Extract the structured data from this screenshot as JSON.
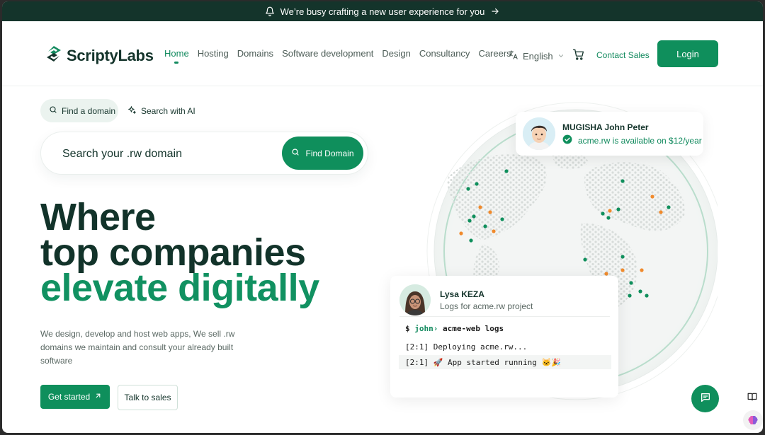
{
  "announcement": {
    "text": "We’re busy crafting a new user experience for you"
  },
  "brand": {
    "name": "ScriptyLabs",
    "primary": "#0f8f5c",
    "dark": "#14342b"
  },
  "nav": {
    "items": [
      {
        "label": "Home",
        "active": true
      },
      {
        "label": "Hosting"
      },
      {
        "label": "Domains"
      },
      {
        "label": "Software development"
      },
      {
        "label": "Design"
      },
      {
        "label": "Consultancy"
      },
      {
        "label": "Careers"
      }
    ],
    "language": "English",
    "contact": "Contact Sales",
    "login": "Login"
  },
  "search": {
    "tab_find": "Find a domain",
    "tab_ai": "Search with AI",
    "placeholder": "Search your .rw domain",
    "button": "Find Domain"
  },
  "hero": {
    "line1": "Where",
    "line2": "top companies",
    "line3": "elevate digitally",
    "subtext": "We design, develop and host web apps, We sell .rw domains we maintain and consult your already built software",
    "cta_primary": "Get started",
    "cta_secondary": "Talk to sales"
  },
  "card_user": {
    "name": "MUGISHA John Peter",
    "status": "acme.rw is available on $12/year"
  },
  "card_logs": {
    "name": "Lysa KEZA",
    "desc": "Logs for acme.rw project",
    "prompt": "$",
    "user": "john›",
    "command": "acme-web logs",
    "line1": "[2:1] Deploying acme.rw...",
    "line2": "[2:1] 🚀 App started running 🐱🎉"
  }
}
